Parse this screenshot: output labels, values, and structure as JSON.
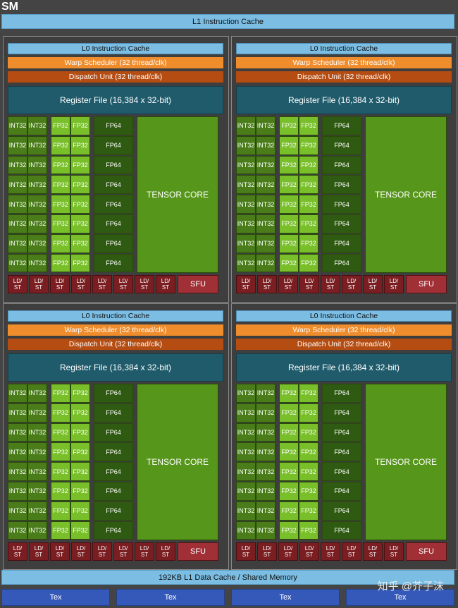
{
  "sm_label": "SM",
  "l1_instruction_cache": "L1 Instruction Cache",
  "l1_data_cache": "192KB L1 Data Cache / Shared Memory",
  "tex_label": "Tex",
  "watermark": "知乎 @芥子沫",
  "processing_block": {
    "l0_cache": "L0 Instruction Cache",
    "warp_scheduler": "Warp Scheduler (32 thread/clk)",
    "dispatch_unit": "Dispatch Unit (32 thread/clk)",
    "register_file": "Register File (16,384 x 32-bit)",
    "int32_label": "INT32",
    "fp32_label": "FP32",
    "fp64_label": "FP64",
    "tensor_core_label": "TENSOR CORE",
    "ldst_label_line1": "LD/",
    "ldst_label_line2": "ST",
    "sfu_label": "SFU"
  },
  "structure": {
    "quadrants": 4,
    "rows_per_block": 8,
    "int32_per_row": 2,
    "fp32_per_row": 2,
    "fp64_per_row": 1,
    "ldst_units": 8,
    "tex_units": 4
  },
  "colors": {
    "background": "#444444",
    "cache": "#7bbde3",
    "warp_scheduler": "#ef8c2c",
    "dispatch_unit": "#b54d12",
    "register_file": "#1f5b6b",
    "int32": "#4a7d1a",
    "fp32": "#78bf2a",
    "fp64": "#2f5a11",
    "tensor_core": "#56961a",
    "ldst": "#7a1e22",
    "sfu": "#a03036",
    "tex": "#3559b8"
  }
}
